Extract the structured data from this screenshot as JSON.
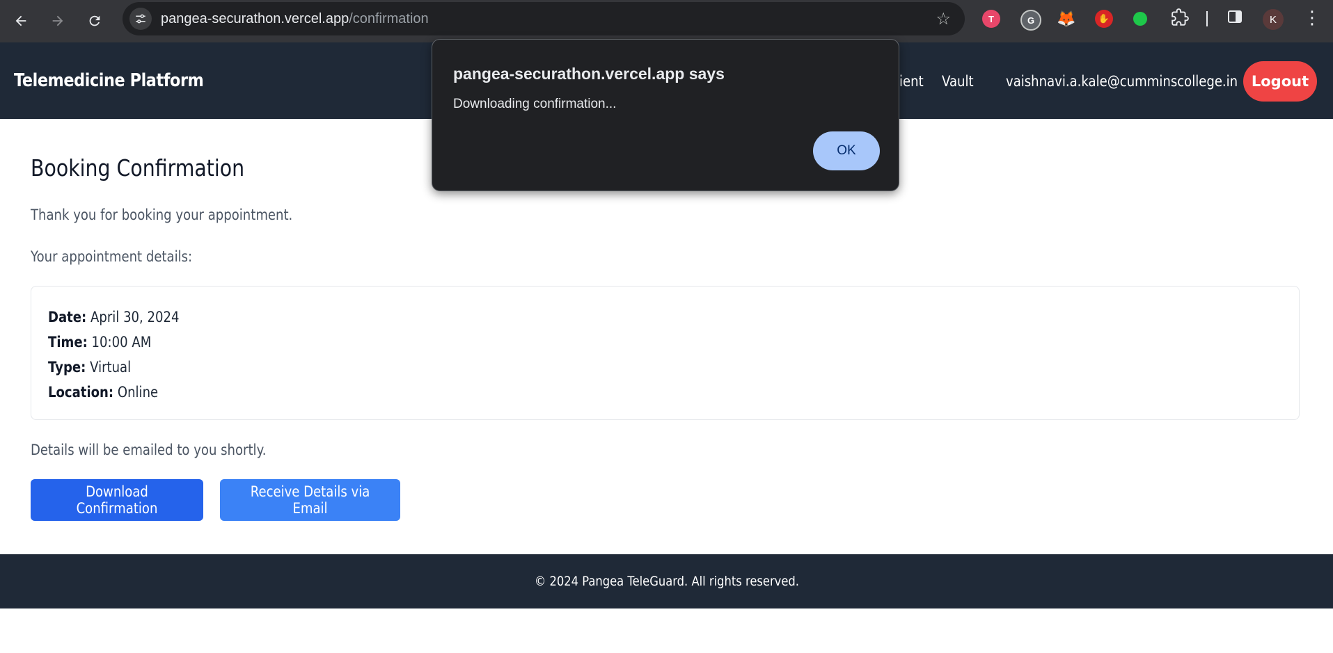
{
  "browser": {
    "url_host": "pangea-securathon.vercel.app",
    "url_path": "/confirmation",
    "profile_initial": "K",
    "icons": {
      "back": "arrow-left-icon",
      "forward": "arrow-right-icon",
      "reload": "reload-icon",
      "site_info": "tune-icon",
      "bookmark": "star-icon",
      "extensions": "puzzle-icon",
      "side_panel": "side-panel-icon",
      "menu": "more-vert-icon"
    }
  },
  "header": {
    "brand": "Telemedicine Platform",
    "nav_partial": "ient",
    "nav_vault": "Vault",
    "user_email": "vaishnavi.a.kale@cumminscollege.in",
    "logout_label": "Logout"
  },
  "main": {
    "title": "Booking Confirmation",
    "thanks": "Thank you for booking your appointment.",
    "details_intro": "Your appointment details:",
    "details": [
      {
        "label": "Date:",
        "value": "April 30, 2024"
      },
      {
        "label": "Time:",
        "value": "10:00 AM"
      },
      {
        "label": "Type:",
        "value": "Virtual"
      },
      {
        "label": "Location:",
        "value": "Online"
      }
    ],
    "email_note": "Details will be emailed to you shortly.",
    "download_label": "Download Confirmation",
    "email_label": "Receive Details via Email"
  },
  "footer": {
    "text": "© 2024 Pangea TeleGuard. All rights reserved."
  },
  "dialog": {
    "title": "pangea-securathon.vercel.app says",
    "message": "Downloading confirmation...",
    "ok_label": "OK"
  },
  "colors": {
    "header_bg": "#1f2937",
    "logout_bg": "#ef4444",
    "primary_button": "#2563eb",
    "secondary_button": "#3b82f6",
    "dialog_ok": "#a8c7fa"
  }
}
